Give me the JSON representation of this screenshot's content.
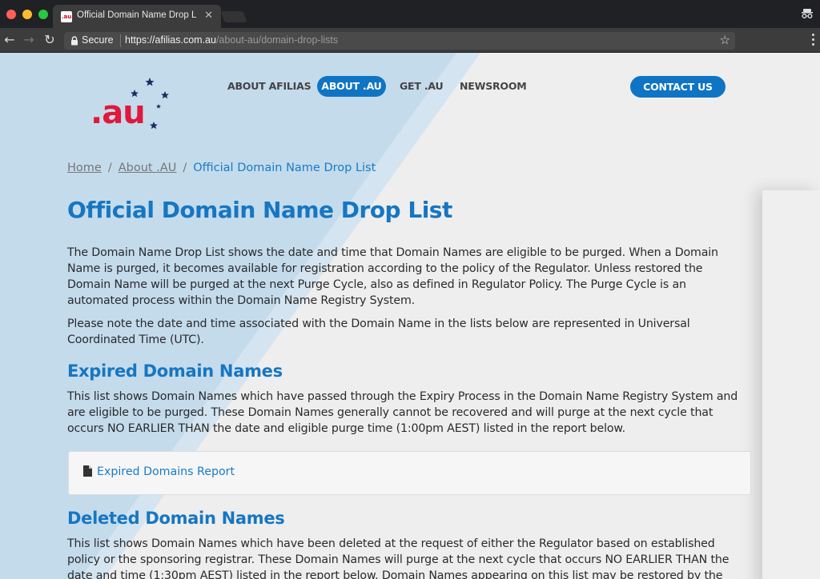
{
  "browser": {
    "tab_title": "Official Domain Name Drop List",
    "tab_favicon_text": ".au",
    "secure_label": "Secure",
    "url_host": "https://afilias.com.au",
    "url_path": "/about-au/domain-drop-lists"
  },
  "site": {
    "logo_text": ".au",
    "nav": {
      "about_afilias": "ABOUT AFILIAS",
      "about_au": "ABOUT .AU",
      "get_au": "GET .AU",
      "newsroom": "NEWSROOM"
    },
    "contact_label": "CONTACT US",
    "colors": {
      "brand_blue": "#0f74c4",
      "logo_red": "#e0183a",
      "star_navy": "#1c2a5e"
    }
  },
  "breadcrumb": {
    "home": "Home",
    "about": "About .AU",
    "current": "Official Domain Name Drop List",
    "separator": "/"
  },
  "main": {
    "title": "Official Domain Name Drop List",
    "intro": "The Domain Name Drop List shows the date and time that Domain Names are eligible to be purged. When a Domain Name is purged, it becomes available for registration according to the policy of the Regulator. Unless restored the Domain Name will be purged at the next Purge Cycle, also as defined in Regulator Policy. The Purge Cycle is an automated process within the Domain Name Registry System.",
    "note": "Please note the date and time associated with the Domain Name in the lists below are represented in Universal Coordinated Time (UTC).",
    "expired": {
      "heading": "Expired Domain Names",
      "body": "This list shows Domain Names which have passed through the Expiry Process in the Domain Name Registry System and are eligible to be purged. These Domain Names generally cannot be recovered and will purge at the next cycle that occurs NO EARLIER THAN the date and eligible purge time (1:00pm AEST) listed in the report below.",
      "report_link": "Expired Domains Report"
    },
    "deleted": {
      "heading": "Deleted Domain Names",
      "body": "This list shows Domain Names which have been deleted at the request of either the Regulator based on established policy or the sponsoring registrar. These Domain Names will purge at the next cycle that occurs NO EARLIER THAN the date and time (1:30pm AEST) listed in the report below. Domain Names appearing on this list may be restored by the"
    }
  }
}
